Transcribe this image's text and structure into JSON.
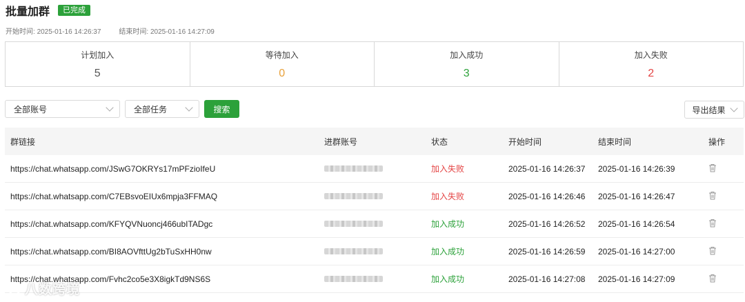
{
  "header": {
    "title": "批量加群",
    "badge": "已完成"
  },
  "times": {
    "start_label": "开始时间:",
    "start_value": "2025-01-16 14:26:37",
    "end_label": "结束时间:",
    "end_value": "2025-01-16 14:27:09"
  },
  "stats": [
    {
      "label": "计划加入",
      "value": "5"
    },
    {
      "label": "等待加入",
      "value": "0"
    },
    {
      "label": "加入成功",
      "value": "3"
    },
    {
      "label": "加入失败",
      "value": "2"
    }
  ],
  "filters": {
    "account": "全部账号",
    "task": "全部任务",
    "search": "搜索",
    "export": "导出结果"
  },
  "table": {
    "headers": {
      "link": "群链接",
      "account": "进群账号",
      "status": "状态",
      "start": "开始时间",
      "end": "结束时间",
      "op": "操作"
    },
    "rows": [
      {
        "link": "https://chat.whatsapp.com/JSwG7OKRYs17mPFzioIfeU",
        "status": "加入失败",
        "start": "2025-01-16 14:26:37",
        "end": "2025-01-16 14:26:39"
      },
      {
        "link": "https://chat.whatsapp.com/C7EBsvoEIUx6mpja3FFMAQ",
        "status": "加入失败",
        "start": "2025-01-16 14:26:46",
        "end": "2025-01-16 14:26:47"
      },
      {
        "link": "https://chat.whatsapp.com/KFYQVNuoncj466ubITADgc",
        "status": "加入成功",
        "start": "2025-01-16 14:26:52",
        "end": "2025-01-16 14:26:54"
      },
      {
        "link": "https://chat.whatsapp.com/BI8AOVfttUg2bTuSxHH0nw",
        "status": "加入成功",
        "start": "2025-01-16 14:26:59",
        "end": "2025-01-16 14:27:00"
      },
      {
        "link": "https://chat.whatsapp.com/Fvhc2co5e3X8igkTd9NS6S",
        "status": "加入成功",
        "start": "2025-01-16 14:27:08",
        "end": "2025-01-16 14:27:09"
      }
    ]
  },
  "watermark": "八数跨境",
  "colors": {
    "green": "#2ca13a",
    "red": "#e44444",
    "orange": "#e8a13a"
  }
}
